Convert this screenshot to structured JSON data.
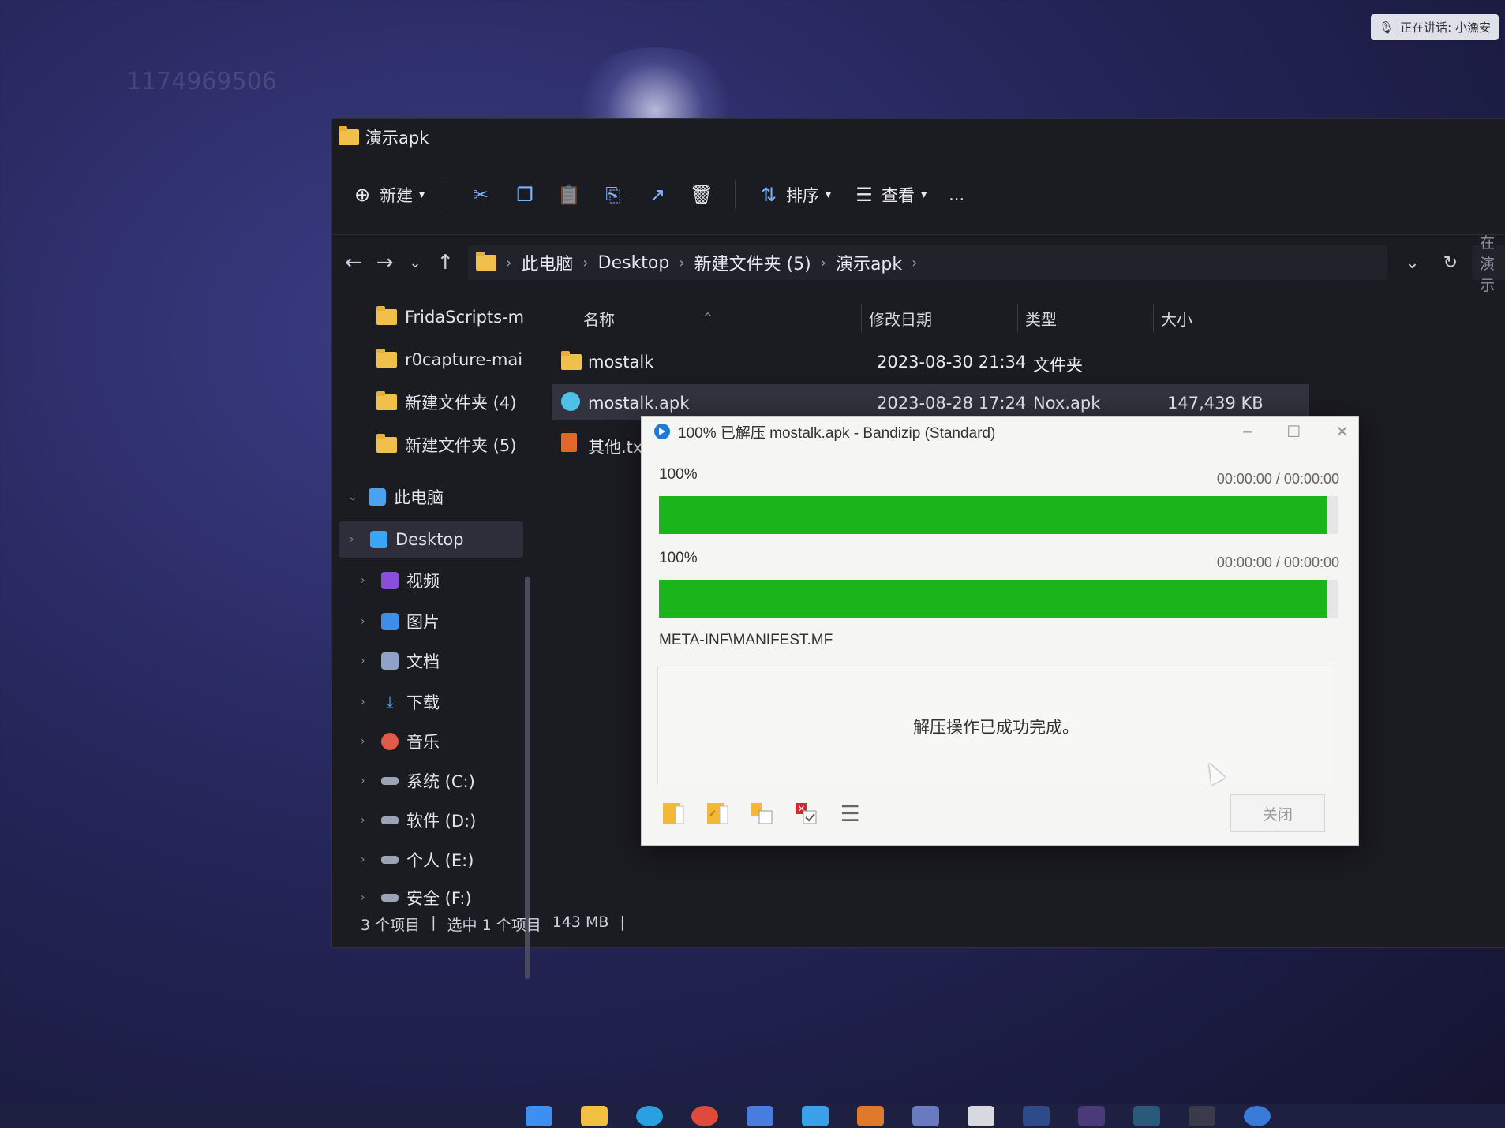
{
  "desktop": {
    "faded_number": "1174969506",
    "status_pill": "正在讲话: 小漁安"
  },
  "explorer": {
    "title": "演示apk",
    "toolbar": {
      "new_label": "新建",
      "sort_label": "排序",
      "view_label": "查看",
      "more_label": "..."
    },
    "breadcrumb": [
      "此电脑",
      "Desktop",
      "新建文件夹 (5)",
      "演示apk"
    ],
    "search_placeholder": "在 演示",
    "sidebar": [
      {
        "label": "FridaScripts-m",
        "kind": "folder"
      },
      {
        "label": "r0capture-mai",
        "kind": "folder"
      },
      {
        "label": "新建文件夹 (4)",
        "kind": "folder"
      },
      {
        "label": "新建文件夹 (5)",
        "kind": "folder"
      },
      {
        "label": "此电脑",
        "kind": "pc"
      },
      {
        "label": "Desktop",
        "kind": "desktop"
      },
      {
        "label": "视频",
        "kind": "video"
      },
      {
        "label": "图片",
        "kind": "pictures"
      },
      {
        "label": "文档",
        "kind": "docs"
      },
      {
        "label": "下载",
        "kind": "download"
      },
      {
        "label": "音乐",
        "kind": "music"
      },
      {
        "label": "系统 (C:)",
        "kind": "drive"
      },
      {
        "label": "软件 (D:)",
        "kind": "drive"
      },
      {
        "label": "个人 (E:)",
        "kind": "drive"
      },
      {
        "label": "安全 (F:)",
        "kind": "drive"
      }
    ],
    "columns": {
      "name": "名称",
      "date": "修改日期",
      "type": "类型",
      "size": "大小"
    },
    "files": [
      {
        "name": "mostalk",
        "date": "2023-08-30 21:34",
        "type": "文件夹",
        "size": ""
      },
      {
        "name": "mostalk.apk",
        "date": "2023-08-28 17:24",
        "type": "Nox.apk",
        "size": "147,439 KB"
      },
      {
        "name": "其他.tx",
        "date": "",
        "type": "",
        "size": ""
      }
    ],
    "status": {
      "count": "3 个项目",
      "selected": "选中 1 个项目",
      "size": "143 MB"
    }
  },
  "dialog": {
    "title": "100% 已解压 mostalk.apk - Bandizip (Standard)",
    "progress1": {
      "label": "100%",
      "time": "00:00:00 / 00:00:00",
      "fraction": 0.985
    },
    "progress2": {
      "label": "100%",
      "time": "00:00:00 / 00:00:00",
      "fraction": 0.985
    },
    "current_file": "META-INF\\MANIFEST.MF",
    "message": "解压操作已成功完成。",
    "close_label": "关闭",
    "colors": {
      "progress": "#1ab51a"
    }
  }
}
